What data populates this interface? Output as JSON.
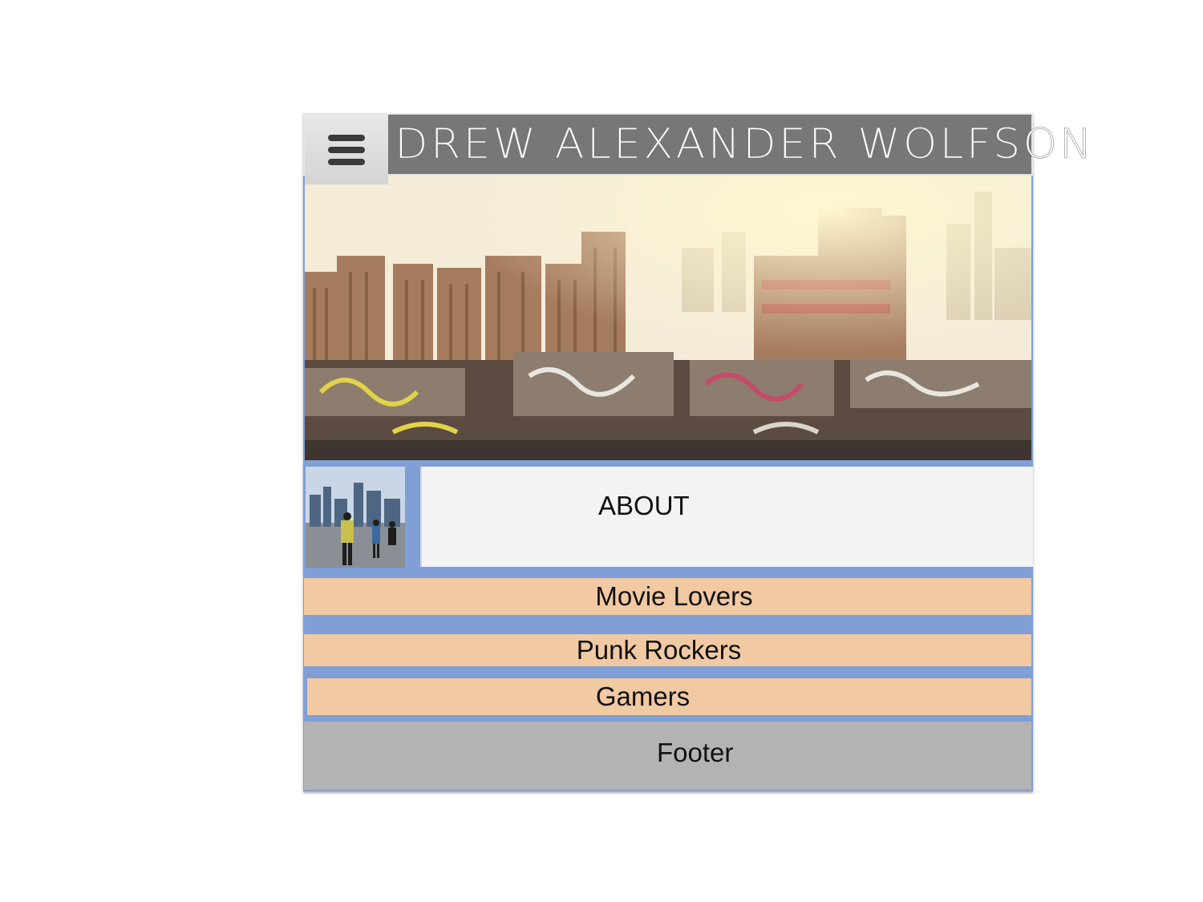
{
  "header": {
    "menu_icon": "hamburger-menu-icon",
    "title": "DREW ALEXANDER WOLFSON"
  },
  "hero": {
    "description_icon": "city-skyline-graffiti-image"
  },
  "about": {
    "thumbnail_icon": "city-people-photo",
    "label": "ABOUT"
  },
  "nav": {
    "items": [
      {
        "label": "Movie Lovers"
      },
      {
        "label": "Punk Rockers"
      },
      {
        "label": "Gamers"
      }
    ]
  },
  "footer": {
    "label": "Footer"
  },
  "colors": {
    "frame_blue": "#7f9fd6",
    "title_bar": "#777777",
    "nav_peach": "#f1c9a2",
    "footer_gray": "#b3b3b3",
    "about_bg": "#f3f3f3"
  }
}
